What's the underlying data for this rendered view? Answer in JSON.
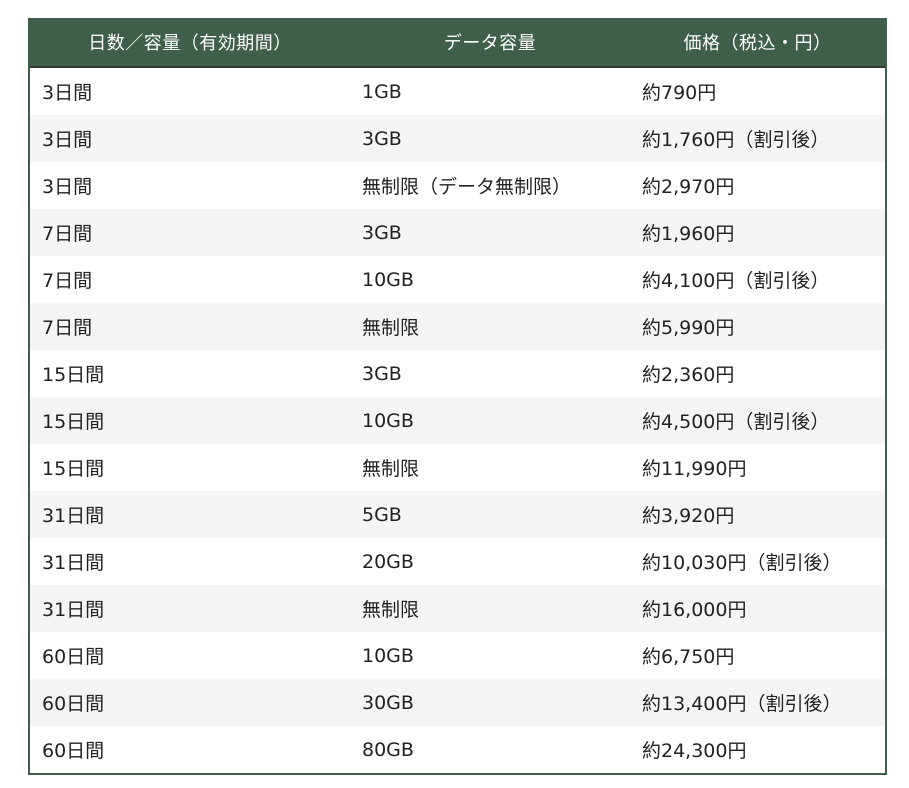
{
  "header": {
    "col_days": "日数／容量（有効期間）",
    "col_data": "データ容量",
    "col_price": "価格（税込・円）"
  },
  "rows": [
    {
      "days": "3日間",
      "data": "1GB",
      "price": "約790円"
    },
    {
      "days": "3日間",
      "data": "3GB",
      "price": "約1,760円（割引後）"
    },
    {
      "days": "3日間",
      "data": "無制限（データ無制限）",
      "price": "約2,970円"
    },
    {
      "days": "7日間",
      "data": "3GB",
      "price": "約1,960円"
    },
    {
      "days": "7日間",
      "data": "10GB",
      "price": "約4,100円（割引後）"
    },
    {
      "days": "7日間",
      "data": "無制限",
      "price": "約5,990円"
    },
    {
      "days": "15日間",
      "data": "3GB",
      "price": "約2,360円"
    },
    {
      "days": "15日間",
      "data": "10GB",
      "price": "約4,500円（割引後）"
    },
    {
      "days": "15日間",
      "data": "無制限",
      "price": "約11,990円"
    },
    {
      "days": "31日間",
      "data": "5GB",
      "price": "約3,920円"
    },
    {
      "days": "31日間",
      "data": "20GB",
      "price": "約10,030円（割引後）"
    },
    {
      "days": "31日間",
      "data": "無制限",
      "price": "約16,000円"
    },
    {
      "days": "60日間",
      "data": "10GB",
      "price": "約6,750円"
    },
    {
      "days": "60日間",
      "data": "30GB",
      "price": "約13,400円（割引後）"
    },
    {
      "days": "60日間",
      "data": "80GB",
      "price": "約24,300円"
    }
  ],
  "colors": {
    "header_bg": "#3f5f4a",
    "header_text": "#ffffff",
    "row_alt_bg": "#f4f5f6",
    "border": "#3f5f4a"
  }
}
